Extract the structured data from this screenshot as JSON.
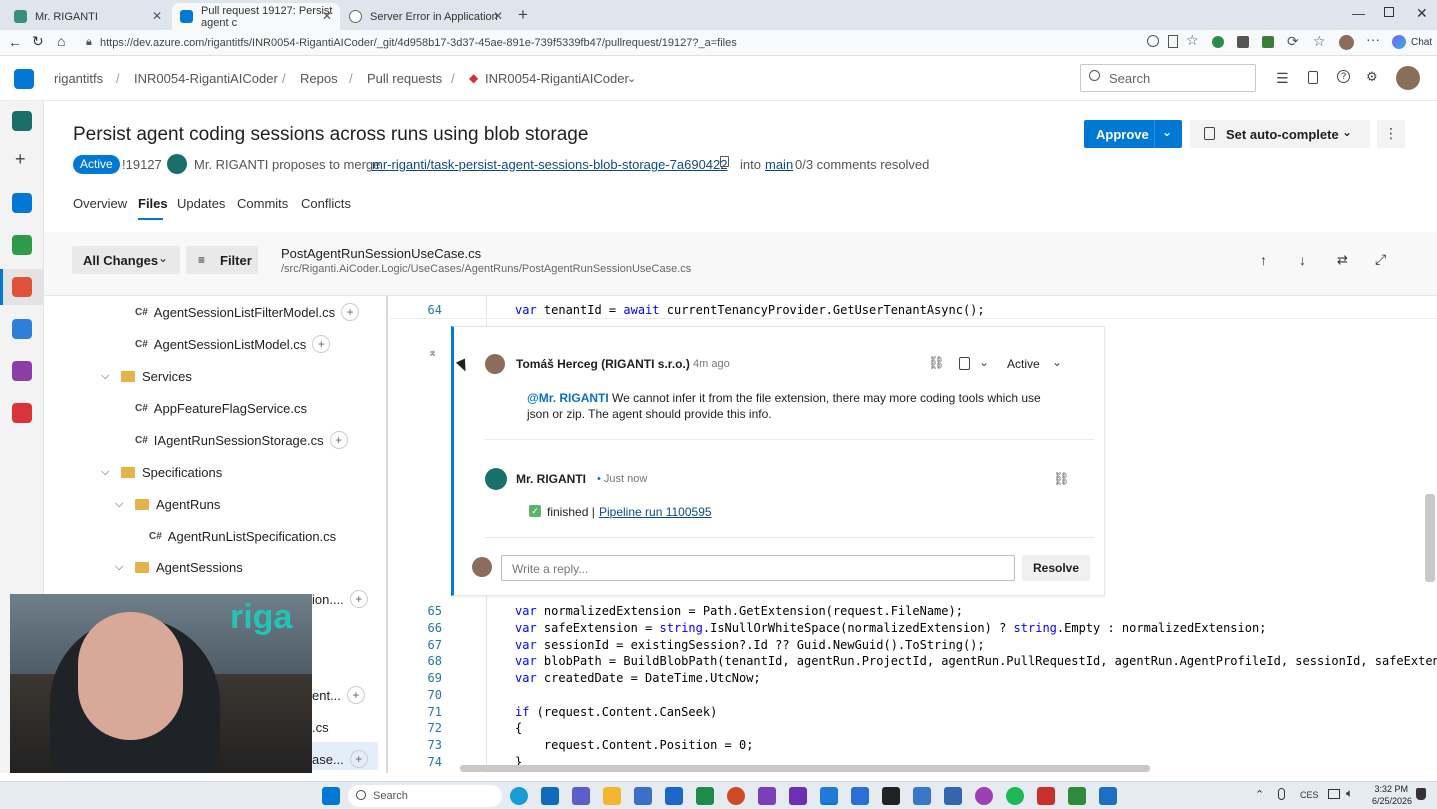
{
  "browser": {
    "tabs": [
      {
        "title": "Mr. RIGANTI",
        "icon_color": "#3a8f7a",
        "active": false
      },
      {
        "title": "Pull request 19127: Persist agent c",
        "icon_color": "#0078d4",
        "active": true
      },
      {
        "title": "Server Error in Application",
        "icon_color": "#6a6a6a",
        "active": false
      }
    ],
    "new_tab_icon": "plus-icon",
    "url": "https://dev.azure.com/rigantitfs/INR0054-RigantiAICoder/_git/4d958b17-3d37-45ae-891e-739f5339fb47/pullrequest/19127?_a=files",
    "chat_label": "Chat"
  },
  "ado": {
    "breadcrumbs": [
      "rigantitfs",
      "INR0054-RigantiAICoder",
      "Repos",
      "Pull requests",
      "INR0054-RigantiAICoder"
    ],
    "search_placeholder": "Search"
  },
  "pr": {
    "title": "Persist agent coding sessions across runs using blob storage",
    "status": "Active",
    "id": "!19127",
    "author_text": "Mr. RIGANTI proposes to merge",
    "source_branch": "mr-riganti/task-persist-agent-sessions-blob-storage-7a690422",
    "into_label": "into",
    "target_branch": "main",
    "comments_resolved": "0/3 comments resolved",
    "approve_label": "Approve",
    "autocomplete_label": "Set auto-complete",
    "tabs": [
      "Overview",
      "Files",
      "Updates",
      "Commits",
      "Conflicts"
    ],
    "active_tab": "Files"
  },
  "files_toolbar": {
    "changes_label": "All Changes",
    "filter_label": "Filter",
    "file_name": "PostAgentRunSessionUseCase.cs",
    "file_path": "/src/Riganti.AiCoder.Logic/UseCases/AgentRuns/PostAgentRunSessionUseCase.cs"
  },
  "tree": [
    {
      "kind": "file",
      "label": "AgentSessionListFilterModel.cs",
      "plus": true
    },
    {
      "kind": "file",
      "label": "AgentSessionListModel.cs",
      "plus": true
    },
    {
      "kind": "folder",
      "label": "Services"
    },
    {
      "kind": "file",
      "label": "AppFeatureFlagService.cs",
      "plus": false
    },
    {
      "kind": "file",
      "label": "IAgentRunSessionStorage.cs",
      "plus": true
    },
    {
      "kind": "folder",
      "label": "Specifications"
    },
    {
      "kind": "folder",
      "label": "AgentRuns"
    },
    {
      "kind": "file",
      "label": "AgentRunListSpecification.cs",
      "plus": false
    },
    {
      "kind": "folder",
      "label": "AgentSessions"
    },
    {
      "kind": "partial",
      "label": "ion....",
      "plus": true
    },
    {
      "kind": "partial",
      "label": "ent...",
      "plus": true
    },
    {
      "kind": "partial",
      "label": ".cs",
      "plus": false
    },
    {
      "kind": "partial",
      "label": "ase...",
      "plus": true
    }
  ],
  "code": {
    "top_line": {
      "num": "64",
      "text": "var tenantId = await currentTenancyProvider.GetUserTenantAsync();"
    },
    "lines": [
      {
        "num": "65",
        "text": "var normalizedExtension = Path.GetExtension(request.FileName);"
      },
      {
        "num": "66",
        "text": "var safeExtension = string.IsNullOrWhiteSpace(normalizedExtension) ? string.Empty : normalizedExtension;"
      },
      {
        "num": "67",
        "text": "var sessionId = existingSession?.Id ?? Guid.NewGuid().ToString();"
      },
      {
        "num": "68",
        "text": "var blobPath = BuildBlobPath(tenantId, agentRun.ProjectId, agentRun.PullRequestId, agentRun.AgentProfileId, sessionId, safeExtension);"
      },
      {
        "num": "69",
        "text": "var createdDate = DateTime.UtcNow;"
      },
      {
        "num": "70",
        "text": ""
      },
      {
        "num": "71",
        "text": "if (request.Content.CanSeek)"
      },
      {
        "num": "72",
        "text": "{"
      },
      {
        "num": "73",
        "text": "    request.Content.Position = 0;"
      },
      {
        "num": "74",
        "text": "}"
      }
    ]
  },
  "thread": {
    "comment1": {
      "author": "Tomáš Herceg (RIGANTI s.r.o.)",
      "time": "4m ago",
      "status": "Active",
      "mention": "@Mr. RIGANTI",
      "text": "We cannot infer it from the file extension, there may more coding tools which use json or zip. The agent should provide this info."
    },
    "comment2": {
      "author": "Mr. RIGANTI",
      "time": "Just now",
      "status_text": "finished |",
      "link": "Pipeline run 1100595"
    },
    "reply_placeholder": "Write a reply...",
    "resolve_label": "Resolve"
  },
  "webcam": {
    "logo_text": "riga"
  },
  "taskbar": {
    "search_placeholder": "Search",
    "lang": "CES",
    "time": "3:32 PM",
    "date": "6/25/2026"
  }
}
